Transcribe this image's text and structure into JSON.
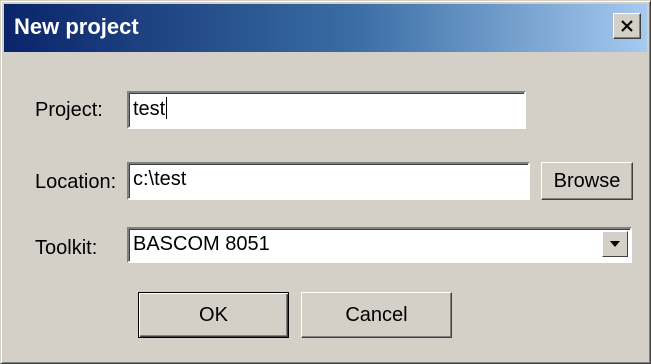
{
  "dialog": {
    "title": "New project",
    "close_icon": "close-x-icon"
  },
  "form": {
    "project_label": "Project:",
    "project_value": "test",
    "location_label": "Location:",
    "location_value": "c:\\test",
    "browse_label": "Browse",
    "toolkit_label": "Toolkit:",
    "toolkit_value": "BASCOM 8051",
    "toolkit_arrow_icon": "chevron-down-icon"
  },
  "buttons": {
    "ok_label": "OK",
    "cancel_label": "Cancel"
  },
  "colors": {
    "title_gradient_start": "#0a246a",
    "title_gradient_end": "#a6caf0",
    "face": "#d4d0c8"
  }
}
